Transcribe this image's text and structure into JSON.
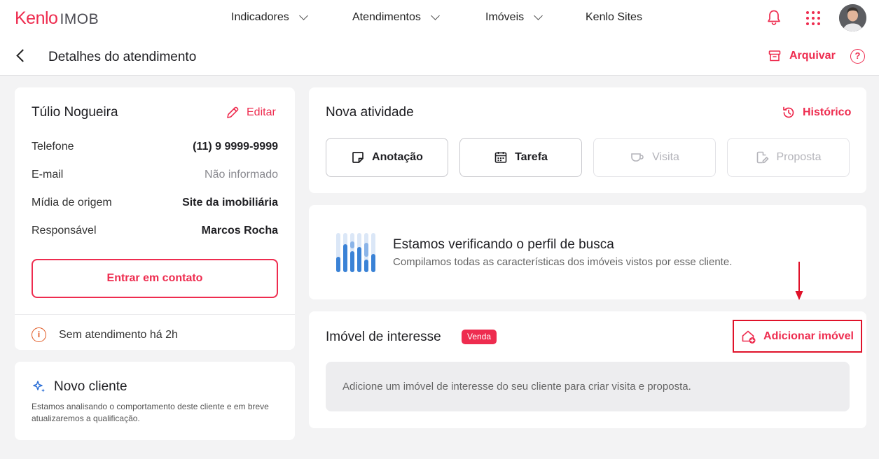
{
  "app": {
    "brand": "Kenlo",
    "product": "IMOB",
    "accent": "#ee2c4f"
  },
  "nav": {
    "items": [
      {
        "label": "Indicadores",
        "has_dropdown": true
      },
      {
        "label": "Atendimentos",
        "has_dropdown": true
      },
      {
        "label": "Imóveis",
        "has_dropdown": true
      },
      {
        "label": "Kenlo Sites",
        "has_dropdown": false
      }
    ],
    "icons": [
      "bell-icon",
      "apps-grid-icon",
      "user-avatar"
    ]
  },
  "header": {
    "title": "Detalhes do atendimento",
    "archive_label": "Arquivar",
    "help_label": "?"
  },
  "client": {
    "name": "Túlio Nogueira",
    "edit_label": "Editar",
    "fields": [
      {
        "label": "Telefone",
        "value": "(11) 9 9999-9999"
      },
      {
        "label": "E-mail",
        "value": "Não informado"
      },
      {
        "label": "Mídia de origem",
        "value": "Site da imobiliária"
      },
      {
        "label": "Responsável",
        "value": "Marcos Rocha"
      }
    ],
    "contact_button": "Entrar em contato",
    "status": "Sem atendimento há 2h"
  },
  "new_client": {
    "title": "Novo cliente",
    "description": "Estamos analisando o comportamento deste cliente e em breve atualizaremos a qualificação."
  },
  "activity": {
    "title": "Nova atividade",
    "history_label": "Histórico",
    "buttons": [
      {
        "label": "Anotação",
        "enabled": true
      },
      {
        "label": "Tarefa",
        "enabled": true
      },
      {
        "label": "Visita",
        "enabled": false
      },
      {
        "label": "Proposta",
        "enabled": false
      }
    ]
  },
  "profile": {
    "title": "Estamos verificando o perfil de busca",
    "description": "Compilamos todas as características dos imóveis vistos por esse cliente."
  },
  "interest": {
    "title": "Imóvel de interesse",
    "badge": "Venda",
    "add_label": "Adicionar imóvel",
    "empty_text": "Adicione um imóvel de interesse do seu cliente para criar visita e proposta."
  }
}
